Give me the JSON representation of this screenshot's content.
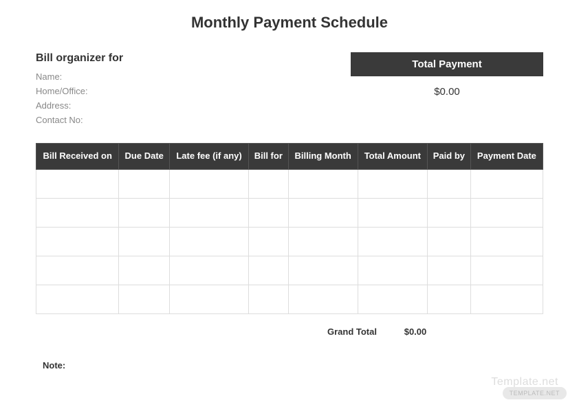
{
  "title": "Monthly Payment Schedule",
  "organizer": {
    "header": "Bill organizer for",
    "fields": {
      "name_label": "Name:",
      "home_office_label": "Home/Office:",
      "address_label": "Address:",
      "contact_no_label": "Contact No:"
    }
  },
  "total_payment": {
    "header": "Total Payment",
    "value": "$0.00"
  },
  "table": {
    "headers": [
      "Bill Received on",
      "Due Date",
      "Late fee (if any)",
      "Bill for",
      "Billing Month",
      "Total Amount",
      "Paid by",
      "Payment Date"
    ],
    "rows": [
      [
        "",
        "",
        "",
        "",
        "",
        "",
        "",
        ""
      ],
      [
        "",
        "",
        "",
        "",
        "",
        "",
        "",
        ""
      ],
      [
        "",
        "",
        "",
        "",
        "",
        "",
        "",
        ""
      ],
      [
        "",
        "",
        "",
        "",
        "",
        "",
        "",
        ""
      ],
      [
        "",
        "",
        "",
        "",
        "",
        "",
        "",
        ""
      ]
    ]
  },
  "grand_total": {
    "label": "Grand Total",
    "value": "$0.00"
  },
  "note_label": "Note:",
  "watermark": "Template.net",
  "watermark_badge": "TEMPLATE.NET"
}
